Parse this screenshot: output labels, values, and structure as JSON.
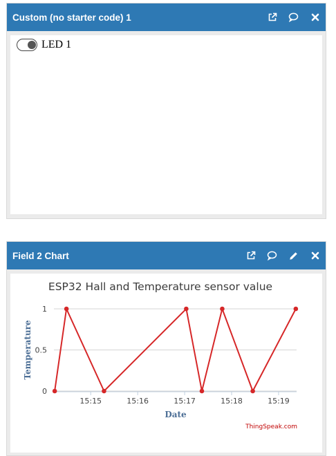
{
  "widgets": [
    {
      "title": "Custom (no starter code) 1",
      "toggle": {
        "label": "LED 1",
        "state": "on"
      }
    },
    {
      "title": "Field 2 Chart"
    }
  ],
  "icons": {
    "open": "external-link-icon",
    "comment": "comment-icon",
    "edit": "pencil-icon",
    "close": "close-icon"
  },
  "colors": {
    "header": "#2e79b4",
    "series": "#d62728",
    "credit": "#c00000"
  },
  "chart_data": {
    "type": "line",
    "title": "ESP32 Hall and Temperature sensor value",
    "xlabel": "Date",
    "ylabel": "Temperature",
    "x_ticks": [
      "15:15",
      "15:16",
      "15:17",
      "15:18",
      "15:19"
    ],
    "y_ticks": [
      "0",
      "0.5",
      "1"
    ],
    "ylim": [
      0,
      1
    ],
    "xlim": [
      "15:14:13",
      "15:19:23"
    ],
    "grid": true,
    "credit": "ThingSpeak.com",
    "series": [
      {
        "x": [
          "15:14:14",
          "15:14:29",
          "15:15:17",
          "15:17:02",
          "15:17:22",
          "15:17:48",
          "15:18:27",
          "15:19:22"
        ],
        "y": [
          0,
          1,
          0,
          1,
          0,
          1,
          0,
          1
        ]
      }
    ]
  }
}
